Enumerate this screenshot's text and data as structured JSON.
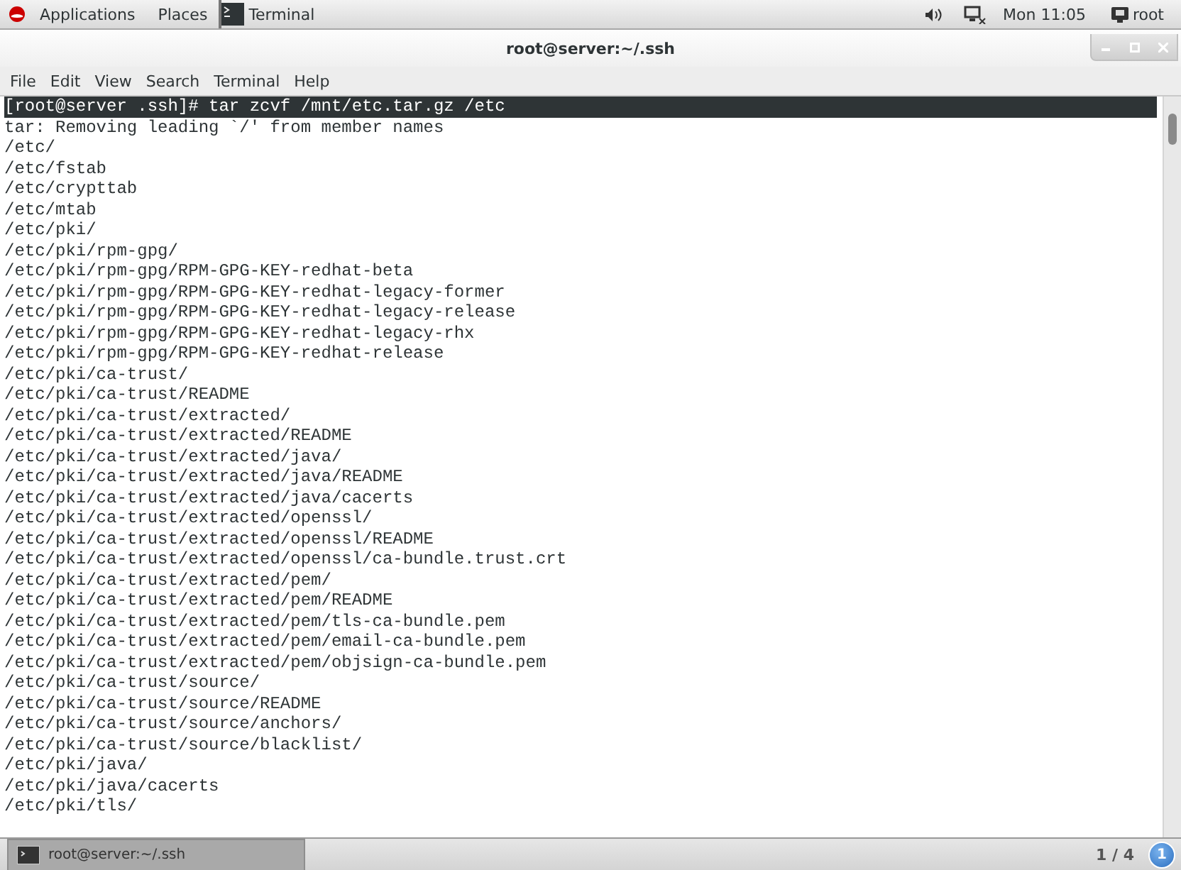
{
  "top_panel": {
    "menus": [
      "Applications",
      "Places"
    ],
    "active_app": "Terminal",
    "clock": "Mon 11:05",
    "user": "root"
  },
  "window": {
    "title": "root@server:~/.ssh"
  },
  "menu_bar": [
    "File",
    "Edit",
    "View",
    "Search",
    "Terminal",
    "Help"
  ],
  "terminal": {
    "lines": [
      {
        "text": "[root@server .ssh]# tar zcvf /mnt/etc.tar.gz /etc",
        "highlighted": true
      },
      {
        "text": "tar: Removing leading `/' from member names",
        "highlighted": false
      },
      {
        "text": "/etc/",
        "highlighted": false
      },
      {
        "text": "/etc/fstab",
        "highlighted": false
      },
      {
        "text": "/etc/crypttab",
        "highlighted": false
      },
      {
        "text": "/etc/mtab",
        "highlighted": false
      },
      {
        "text": "/etc/pki/",
        "highlighted": false
      },
      {
        "text": "/etc/pki/rpm-gpg/",
        "highlighted": false
      },
      {
        "text": "/etc/pki/rpm-gpg/RPM-GPG-KEY-redhat-beta",
        "highlighted": false
      },
      {
        "text": "/etc/pki/rpm-gpg/RPM-GPG-KEY-redhat-legacy-former",
        "highlighted": false
      },
      {
        "text": "/etc/pki/rpm-gpg/RPM-GPG-KEY-redhat-legacy-release",
        "highlighted": false
      },
      {
        "text": "/etc/pki/rpm-gpg/RPM-GPG-KEY-redhat-legacy-rhx",
        "highlighted": false
      },
      {
        "text": "/etc/pki/rpm-gpg/RPM-GPG-KEY-redhat-release",
        "highlighted": false
      },
      {
        "text": "/etc/pki/ca-trust/",
        "highlighted": false
      },
      {
        "text": "/etc/pki/ca-trust/README",
        "highlighted": false
      },
      {
        "text": "/etc/pki/ca-trust/extracted/",
        "highlighted": false
      },
      {
        "text": "/etc/pki/ca-trust/extracted/README",
        "highlighted": false
      },
      {
        "text": "/etc/pki/ca-trust/extracted/java/",
        "highlighted": false
      },
      {
        "text": "/etc/pki/ca-trust/extracted/java/README",
        "highlighted": false
      },
      {
        "text": "/etc/pki/ca-trust/extracted/java/cacerts",
        "highlighted": false
      },
      {
        "text": "/etc/pki/ca-trust/extracted/openssl/",
        "highlighted": false
      },
      {
        "text": "/etc/pki/ca-trust/extracted/openssl/README",
        "highlighted": false
      },
      {
        "text": "/etc/pki/ca-trust/extracted/openssl/ca-bundle.trust.crt",
        "highlighted": false
      },
      {
        "text": "/etc/pki/ca-trust/extracted/pem/",
        "highlighted": false
      },
      {
        "text": "/etc/pki/ca-trust/extracted/pem/README",
        "highlighted": false
      },
      {
        "text": "/etc/pki/ca-trust/extracted/pem/tls-ca-bundle.pem",
        "highlighted": false
      },
      {
        "text": "/etc/pki/ca-trust/extracted/pem/email-ca-bundle.pem",
        "highlighted": false
      },
      {
        "text": "/etc/pki/ca-trust/extracted/pem/objsign-ca-bundle.pem",
        "highlighted": false
      },
      {
        "text": "/etc/pki/ca-trust/source/",
        "highlighted": false
      },
      {
        "text": "/etc/pki/ca-trust/source/README",
        "highlighted": false
      },
      {
        "text": "/etc/pki/ca-trust/source/anchors/",
        "highlighted": false
      },
      {
        "text": "/etc/pki/ca-trust/source/blacklist/",
        "highlighted": false
      },
      {
        "text": "/etc/pki/java/",
        "highlighted": false
      },
      {
        "text": "/etc/pki/java/cacerts",
        "highlighted": false
      },
      {
        "text": "/etc/pki/tls/",
        "highlighted": false
      }
    ]
  },
  "taskbar": {
    "tasks": [
      {
        "label": "root@server:~/.ssh",
        "selected": true
      }
    ],
    "workspace": "1 / 4",
    "notifications": "1"
  }
}
